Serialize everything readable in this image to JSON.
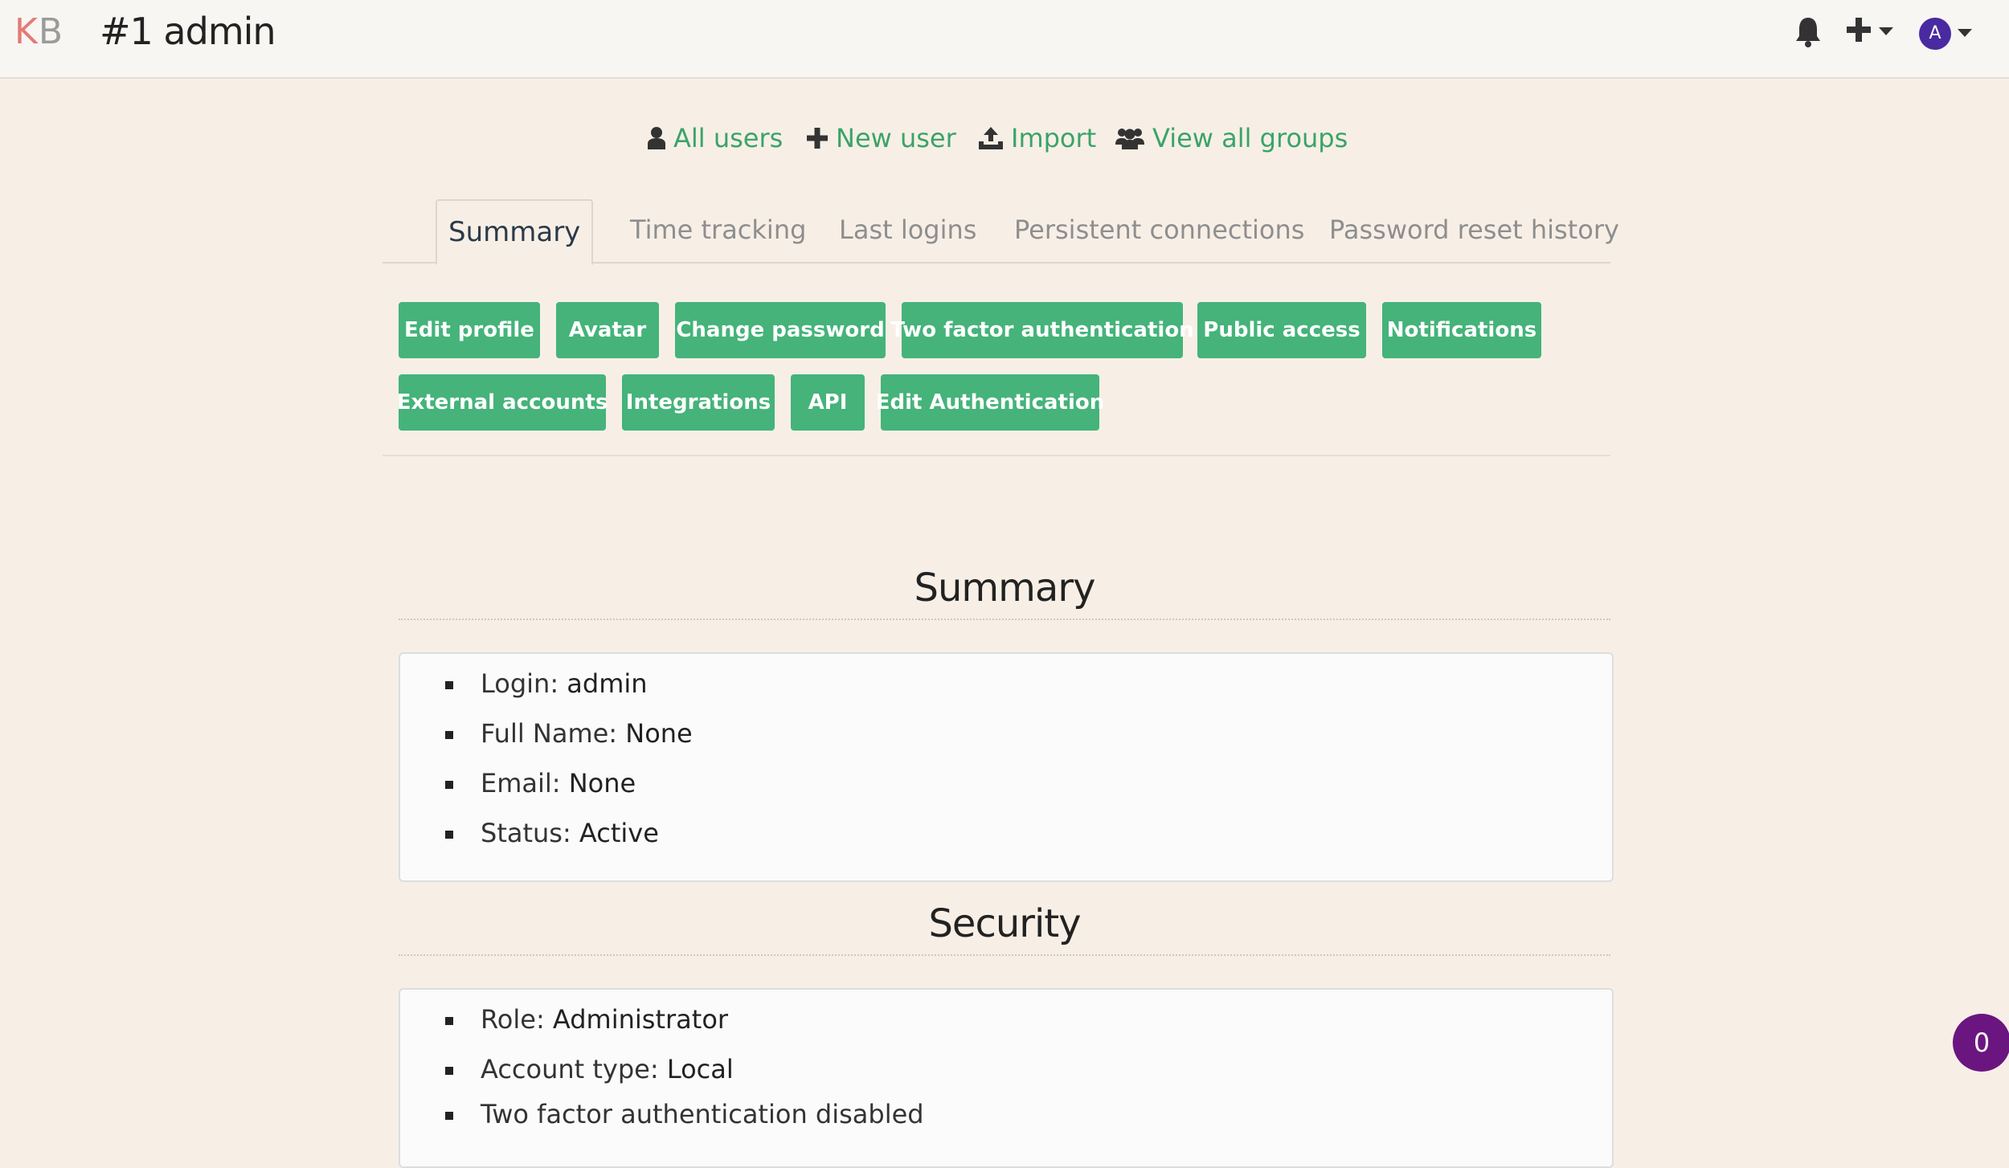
{
  "header": {
    "logo_k": "K",
    "logo_b": "B",
    "title": "#1 admin",
    "avatar_letter": "A"
  },
  "user_actions": [
    {
      "label": "All users",
      "icon": "user-icon"
    },
    {
      "label": "New user",
      "icon": "plus-icon"
    },
    {
      "label": "Import",
      "icon": "upload-icon"
    },
    {
      "label": "View all groups",
      "icon": "users-icon"
    }
  ],
  "tabs": [
    {
      "label": "Summary",
      "active": true
    },
    {
      "label": "Time tracking"
    },
    {
      "label": "Last logins"
    },
    {
      "label": "Persistent connections"
    },
    {
      "label": "Password reset history"
    }
  ],
  "buttons": [
    "Edit profile",
    "Avatar",
    "Change password",
    "Two factor authentication",
    "Public access",
    "Notifications",
    "External accounts",
    "Integrations",
    "API",
    "Edit Authentication"
  ],
  "summary": {
    "title": "Summary",
    "items": [
      {
        "label": "Login:",
        "value": "admin"
      },
      {
        "label": "Full Name:",
        "value": "None"
      },
      {
        "label": "Email:",
        "value": "None"
      },
      {
        "label": "Status:",
        "value": "Active"
      }
    ]
  },
  "security": {
    "title": "Security",
    "items": [
      {
        "label": "Role:",
        "value": "Administrator"
      },
      {
        "label": "Account type:",
        "value": "Local"
      },
      {
        "label": "Two factor authentication disabled",
        "value": ""
      }
    ]
  },
  "badge": "0",
  "colors": {
    "accent": "#45b37a",
    "link": "#3aa468",
    "avatar": "#4a2aa0",
    "badge": "#6b1680"
  }
}
